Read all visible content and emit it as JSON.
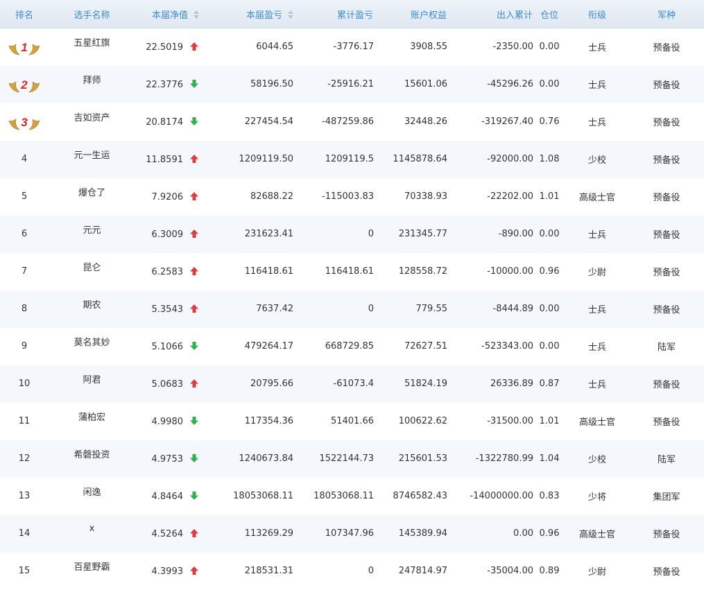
{
  "headers": {
    "rank": "排名",
    "name": "选手名称",
    "net_value": "本届净值",
    "profit": "本届盈亏",
    "cumulative": "累计盈亏",
    "equity": "账户权益",
    "inout": "出入累计",
    "position": "仓位",
    "title": "衔级",
    "branch": "军种"
  },
  "colors": {
    "up": "#e23b3b",
    "down": "#2eb24a",
    "header_text": "#3d8bd6",
    "medal": "#d2a23c",
    "medal_number": "#e02424"
  },
  "rows": [
    {
      "rank": "1",
      "medal": true,
      "name": "五星红旗",
      "net": "22.5019",
      "dir": "up",
      "profit": "6044.65",
      "cum": "-3776.17",
      "equity": "3908.55",
      "inout": "-2350.00",
      "pos": "0.00",
      "title": "士兵",
      "branch": "预备役"
    },
    {
      "rank": "2",
      "medal": true,
      "name": "拜师",
      "net": "22.3776",
      "dir": "down",
      "profit": "58196.50",
      "cum": "-25916.21",
      "equity": "15601.06",
      "inout": "-45296.26",
      "pos": "0.00",
      "title": "士兵",
      "branch": "预备役"
    },
    {
      "rank": "3",
      "medal": true,
      "name": "吉如资产",
      "net": "20.8174",
      "dir": "down",
      "profit": "227454.54",
      "cum": "-487259.86",
      "equity": "32448.26",
      "inout": "-319267.40",
      "pos": "0.76",
      "title": "士兵",
      "branch": "预备役"
    },
    {
      "rank": "4",
      "medal": false,
      "name": "元一生运",
      "net": "11.8591",
      "dir": "up",
      "profit": "1209119.50",
      "cum": "1209119.5",
      "equity": "1145878.64",
      "inout": "-92000.00",
      "pos": "1.08",
      "title": "少校",
      "branch": "预备役"
    },
    {
      "rank": "5",
      "medal": false,
      "name": "爆仓了",
      "net": "7.9206",
      "dir": "up",
      "profit": "82688.22",
      "cum": "-115003.83",
      "equity": "70338.93",
      "inout": "-22202.00",
      "pos": "1.01",
      "title": "高级士官",
      "branch": "预备役"
    },
    {
      "rank": "6",
      "medal": false,
      "name": "元元",
      "net": "6.3009",
      "dir": "up",
      "profit": "231623.41",
      "cum": "0",
      "equity": "231345.77",
      "inout": "-890.00",
      "pos": "0.00",
      "title": "士兵",
      "branch": "预备役"
    },
    {
      "rank": "7",
      "medal": false,
      "name": "昆仑",
      "net": "6.2583",
      "dir": "up",
      "profit": "116418.61",
      "cum": "116418.61",
      "equity": "128558.72",
      "inout": "-10000.00",
      "pos": "0.96",
      "title": "少尉",
      "branch": "预备役"
    },
    {
      "rank": "8",
      "medal": false,
      "name": "期农",
      "net": "5.3543",
      "dir": "up",
      "profit": "7637.42",
      "cum": "0",
      "equity": "779.55",
      "inout": "-8444.89",
      "pos": "0.00",
      "title": "士兵",
      "branch": "预备役"
    },
    {
      "rank": "9",
      "medal": false,
      "name": "莫名其妙",
      "net": "5.1066",
      "dir": "down",
      "profit": "479264.17",
      "cum": "668729.85",
      "equity": "72627.51",
      "inout": "-523343.00",
      "pos": "0.00",
      "title": "士兵",
      "branch": "陆军"
    },
    {
      "rank": "10",
      "medal": false,
      "name": "阿君",
      "net": "5.0683",
      "dir": "up",
      "profit": "20795.66",
      "cum": "-61073.4",
      "equity": "51824.19",
      "inout": "26336.89",
      "pos": "0.87",
      "title": "士兵",
      "branch": "预备役"
    },
    {
      "rank": "11",
      "medal": false,
      "name": "蒲柏宏",
      "net": "4.9980",
      "dir": "down",
      "profit": "117354.36",
      "cum": "51401.66",
      "equity": "100622.62",
      "inout": "-31500.00",
      "pos": "1.01",
      "title": "高级士官",
      "branch": "预备役"
    },
    {
      "rank": "12",
      "medal": false,
      "name": "希磬投资",
      "net": "4.9753",
      "dir": "down",
      "profit": "1240673.84",
      "cum": "1522144.73",
      "equity": "215601.53",
      "inout": "-1322780.99",
      "pos": "1.04",
      "title": "少校",
      "branch": "陆军"
    },
    {
      "rank": "13",
      "medal": false,
      "name": "闲逸",
      "net": "4.8464",
      "dir": "down",
      "profit": "18053068.11",
      "cum": "18053068.11",
      "equity": "8746582.43",
      "inout": "-14000000.00",
      "pos": "0.83",
      "title": "少将",
      "branch": "集团军"
    },
    {
      "rank": "14",
      "medal": false,
      "name": "x",
      "net": "4.5264",
      "dir": "up",
      "profit": "113269.29",
      "cum": "107347.96",
      "equity": "145389.94",
      "inout": "0.00",
      "pos": "0.96",
      "title": "高级士官",
      "branch": "预备役"
    },
    {
      "rank": "15",
      "medal": false,
      "name": "百星野霸",
      "net": "4.3993",
      "dir": "up",
      "profit": "218531.31",
      "cum": "0",
      "equity": "247814.97",
      "inout": "-35004.00",
      "pos": "0.89",
      "title": "少尉",
      "branch": "预备役"
    }
  ]
}
